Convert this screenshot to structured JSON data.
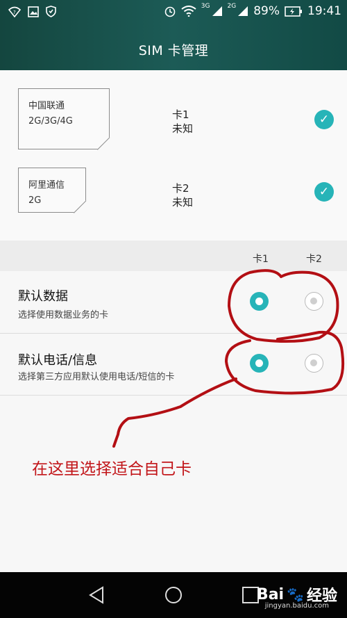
{
  "status": {
    "network_3g": "3G",
    "network_2g": "2G",
    "battery": "89%",
    "time": "19:41"
  },
  "header": {
    "title": "SIM 卡管理"
  },
  "cards": [
    {
      "carrier": "中国联通",
      "network": "2G/3G/4G",
      "slot": "卡1",
      "state": "未知"
    },
    {
      "carrier": "阿里通信",
      "network": "2G",
      "slot": "卡2",
      "state": "未知"
    }
  ],
  "columns": {
    "card1": "卡1",
    "card2": "卡2"
  },
  "settings": {
    "data": {
      "title": "默认数据",
      "subtitle": "选择使用数据业务的卡"
    },
    "call": {
      "title": "默认电话/信息",
      "subtitle": "选择第三方应用默认使用电话/短信的卡"
    }
  },
  "annotation": {
    "text": "在这里选择适合自己卡"
  },
  "watermark": {
    "brand": "Bai",
    "brand2": "经验",
    "url": "jingyan.baidu.com"
  },
  "colors": {
    "accent": "#27b4b8",
    "annotation": "#c2161a",
    "header": "#1c5b56"
  }
}
